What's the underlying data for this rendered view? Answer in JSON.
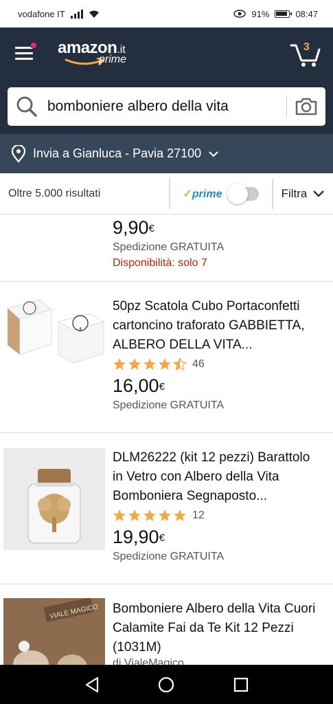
{
  "status": {
    "carrier": "vodafone IT",
    "battery": "91%",
    "time": "08:47"
  },
  "header": {
    "logo_word": "amazon",
    "logo_tld": ".it",
    "logo_sub": "prime",
    "cart_count": "3"
  },
  "search": {
    "query": "bomboniere albero della vita"
  },
  "delivery": {
    "text": "Invia a Gianluca - Pavia 27100"
  },
  "filters": {
    "results": "Oltre 5.000 risultati",
    "prime_check": "✓",
    "prime_label": "prime",
    "filter_label": "Filtra"
  },
  "colors": {
    "header_bg": "#232f3e",
    "delivery_bg": "#37475a",
    "star": "#f3a847",
    "avail": "#b12704",
    "prime_blue": "#1c8fd1"
  },
  "products": [
    {
      "price": "9,90",
      "currency": "€",
      "shipping": "Spedizione GRATUITA",
      "availability": "Disponibilità: solo 7"
    },
    {
      "title": "50pz Scatola Cubo Portaconfetti cartoncino traforato GABBIETTA, ALBERO DELLA VITA...",
      "rating": 4.5,
      "reviews": "46",
      "price": "16,00",
      "currency": "€",
      "shipping": "Spedizione GRATUITA"
    },
    {
      "title": "DLM26222 (kit 12 pezzi) Baratto­lo in Vetro con Albero della Vita Bomboniera Segnaposto...",
      "rating": 5,
      "reviews": "12",
      "price": "19,90",
      "currency": "€",
      "shipping": "Spedizione GRATUITA"
    },
    {
      "title": "Bomboniere Albero della Vita Cuori Calamite Fai da Te Kit 12 Pezzi (1031M)",
      "byline": "di VialeMagico",
      "thumb_text": "VIALE MAGICO"
    }
  ]
}
